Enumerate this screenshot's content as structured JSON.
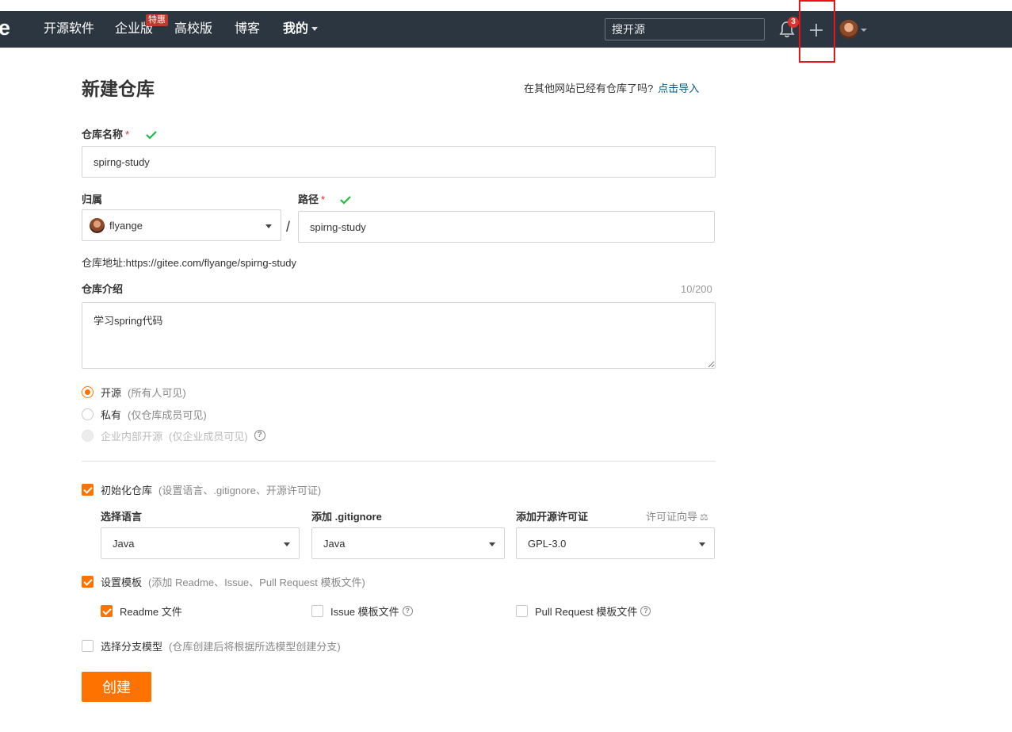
{
  "nav": {
    "logo": "e",
    "items": [
      "开源软件",
      "企业版",
      "高校版",
      "博客"
    ],
    "mine": "我的",
    "promo_badge": "特惠",
    "search_placeholder": "搜开源",
    "notification_count": "3"
  },
  "page": {
    "title": "新建仓库",
    "import_question": "在其他网站已经有仓库了吗?",
    "import_link": "点击导入"
  },
  "form": {
    "repo_name_label": "仓库名称",
    "repo_name_value": "spirng-study",
    "owner_label": "归属",
    "owner_value": "flyange",
    "path_label": "路径",
    "path_value": "spirng-study",
    "required_mark": "*",
    "separator": "/",
    "address_label": "仓库地址:",
    "address_value": "https://gitee.com/flyange/spirng-study",
    "intro_label": "仓库介绍",
    "intro_counter": "10/200",
    "intro_value": "学习spring代码"
  },
  "visibility": [
    {
      "label": "开源",
      "hint": "(所有人可见)",
      "state": "checked"
    },
    {
      "label": "私有",
      "hint": "(仅仓库成员可见)",
      "state": "unchecked"
    },
    {
      "label": "企业内部开源",
      "hint": "(仅企业成员可见)",
      "state": "disabled"
    }
  ],
  "init": {
    "label": "初始化仓库",
    "hint": "(设置语言、.gitignore、开源许可证)",
    "checked": true,
    "language_label": "选择语言",
    "language_value": "Java",
    "gitignore_label": "添加 .gitignore",
    "gitignore_value": "Java",
    "license_label": "添加开源许可证",
    "license_value": "GPL-3.0",
    "license_guide": "许可证向导"
  },
  "template": {
    "label": "设置模板",
    "hint": "(添加 Readme、Issue、Pull Request 模板文件)",
    "checked": true,
    "options": [
      {
        "label": "Readme 文件",
        "checked": true
      },
      {
        "label": "Issue 模板文件",
        "checked": false
      },
      {
        "label": "Pull Request 模板文件",
        "checked": false
      }
    ]
  },
  "branch": {
    "label": "选择分支模型",
    "hint": "(仓库创建后将根据所选模型创建分支)",
    "checked": false
  },
  "submit_label": "创建",
  "colors": {
    "nav_bg": "#2b3640",
    "accent": "#fe7300",
    "link": "#005980",
    "required": "#db2828",
    "success": "#21ba45",
    "highlight": "#e8141b"
  }
}
